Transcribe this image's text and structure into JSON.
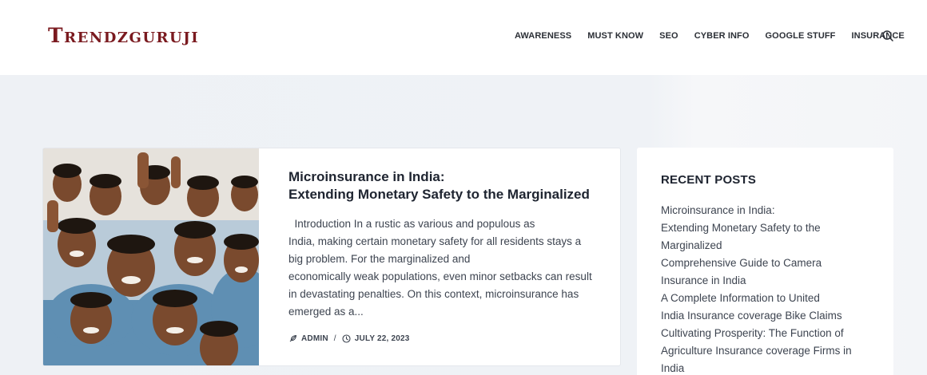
{
  "site": {
    "logo": "Trendzguruji",
    "brand_color": "#7a1a1f"
  },
  "nav": {
    "items": [
      "AWARENESS",
      "MUST KNOW",
      "SEO",
      "CYBER INFO",
      "GOOGLE STUFF",
      "INSURANCE"
    ],
    "search_icon": "search-icon"
  },
  "post": {
    "title_lines": [
      "Microinsurance in India:",
      "Extending Monetary Safety to the Marginalized"
    ],
    "excerpt_lines": [
      "  Introduction In a rustic as various and populous as",
      "India, making certain monetary safety for all residents stays a",
      "big problem. For the marginalized and",
      "economically weak populations, even minor setbacks can result",
      "in devastating penalties. On this context, microinsurance has",
      "emerged as a..."
    ],
    "author": "ADMIN",
    "separator": "/",
    "date": "JULY 22, 2023",
    "author_icon": "feather-icon",
    "date_icon": "clock-icon"
  },
  "sidebar": {
    "widget_title": "RECENT POSTS",
    "recent_posts": [
      [
        "Microinsurance in India:",
        "Extending Monetary Safety to the",
        "Marginalized"
      ],
      [
        "Comprehensive Guide to Camera",
        "Insurance in India"
      ],
      [
        "A Complete Information to United",
        "India Insurance coverage Bike Claims"
      ],
      [
        "Cultivating Prosperity: The Function of",
        "Agriculture Insurance coverage Firms in",
        "India"
      ]
    ]
  }
}
